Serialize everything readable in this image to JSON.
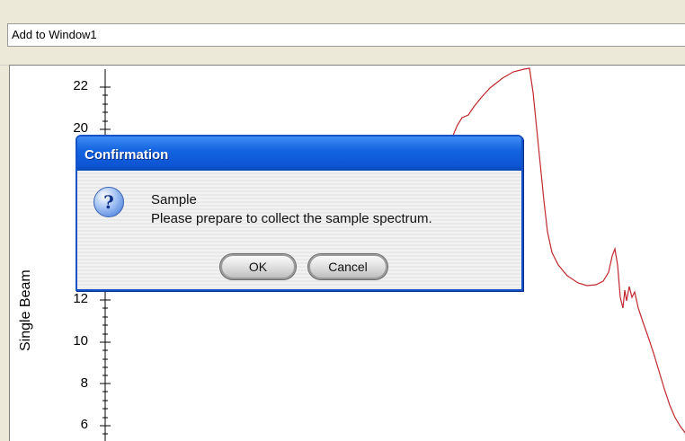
{
  "window_selector": {
    "value": "Add to Window1"
  },
  "plot": {
    "ylabel": "Single Beam",
    "yticks": [
      "22",
      "20",
      "12",
      "10",
      "8",
      "6"
    ],
    "line_color": "#c0282e"
  },
  "dialog": {
    "title": "Confirmation",
    "icon": "question-icon",
    "heading": "Sample",
    "message": "Please prepare to collect the sample spectrum.",
    "ok_label": "OK",
    "cancel_label": "Cancel"
  }
}
